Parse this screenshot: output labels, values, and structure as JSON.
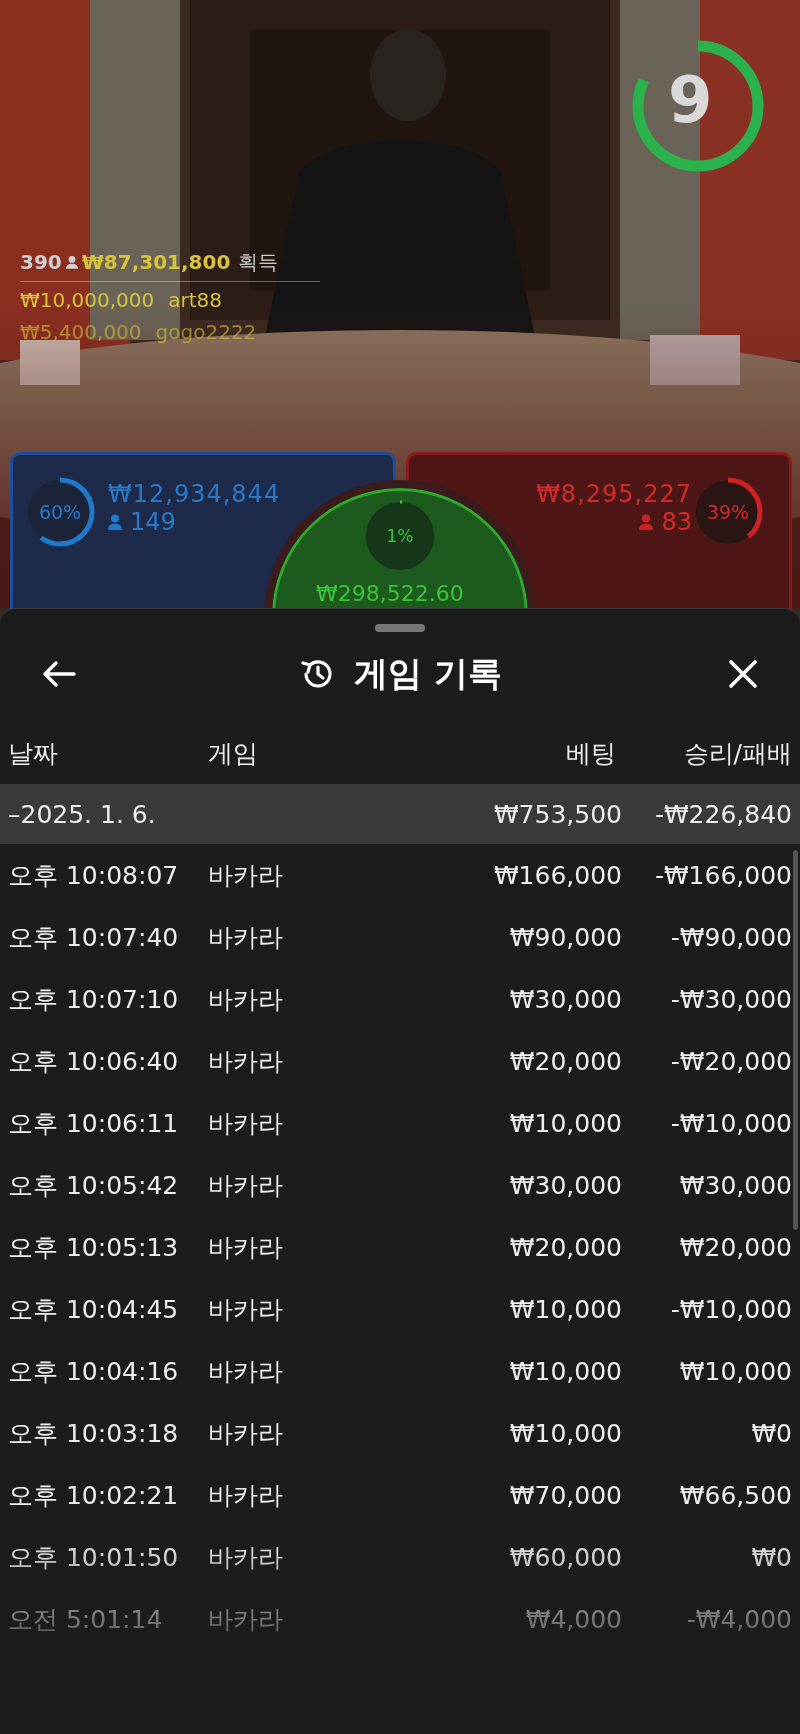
{
  "stream": {
    "kind": "picture",
    "timer": {
      "value": "9",
      "level": 0.82
    },
    "winners": {
      "count": "390",
      "total": "₩87,301,800",
      "label": "획득",
      "list": [
        {
          "amount": "₩10,000,000",
          "name": "art88"
        },
        {
          "amount": "₩5,400,000",
          "name": "gogo2222"
        }
      ]
    },
    "bets": {
      "player": {
        "percent": "60%",
        "level": 0.6,
        "amount": "₩12,934,844",
        "players": "149"
      },
      "tie": {
        "percent": "1%",
        "level": 0.01,
        "amount": "₩298,522.60"
      },
      "banker": {
        "percent": "39%",
        "level": 0.39,
        "amount": "₩8,295,227",
        "players": "83"
      }
    }
  },
  "sheet": {
    "title": "게임 기록",
    "columns": [
      "날짜",
      "게임",
      "베팅",
      "승리/패배"
    ],
    "group": {
      "date": "–2025. 1. 6.",
      "bet": "₩753,500",
      "result": "-₩226,840"
    },
    "rows": [
      {
        "time": "오후 10:08:07",
        "game": "바카라",
        "bet": "₩166,000",
        "result": "-₩166,000"
      },
      {
        "time": "오후 10:07:40",
        "game": "바카라",
        "bet": "₩90,000",
        "result": "-₩90,000"
      },
      {
        "time": "오후 10:07:10",
        "game": "바카라",
        "bet": "₩30,000",
        "result": "-₩30,000"
      },
      {
        "time": "오후 10:06:40",
        "game": "바카라",
        "bet": "₩20,000",
        "result": "-₩20,000"
      },
      {
        "time": "오후 10:06:11",
        "game": "바카라",
        "bet": "₩10,000",
        "result": "-₩10,000"
      },
      {
        "time": "오후 10:05:42",
        "game": "바카라",
        "bet": "₩30,000",
        "result": "₩30,000"
      },
      {
        "time": "오후 10:05:13",
        "game": "바카라",
        "bet": "₩20,000",
        "result": "₩20,000"
      },
      {
        "time": "오후 10:04:45",
        "game": "바카라",
        "bet": "₩10,000",
        "result": "-₩10,000"
      },
      {
        "time": "오후 10:04:16",
        "game": "바카라",
        "bet": "₩10,000",
        "result": "₩10,000"
      },
      {
        "time": "오후 10:03:18",
        "game": "바카라",
        "bet": "₩10,000",
        "result": "₩0"
      },
      {
        "time": "오후 10:02:21",
        "game": "바카라",
        "bet": "₩70,000",
        "result": "₩66,500"
      },
      {
        "time": "오후 10:01:50",
        "game": "바카라",
        "bet": "₩60,000",
        "result": "₩0"
      },
      {
        "time": "오전 5:01:14",
        "game": "바카라",
        "bet": "₩4,000",
        "result": "-₩4,000"
      }
    ]
  }
}
